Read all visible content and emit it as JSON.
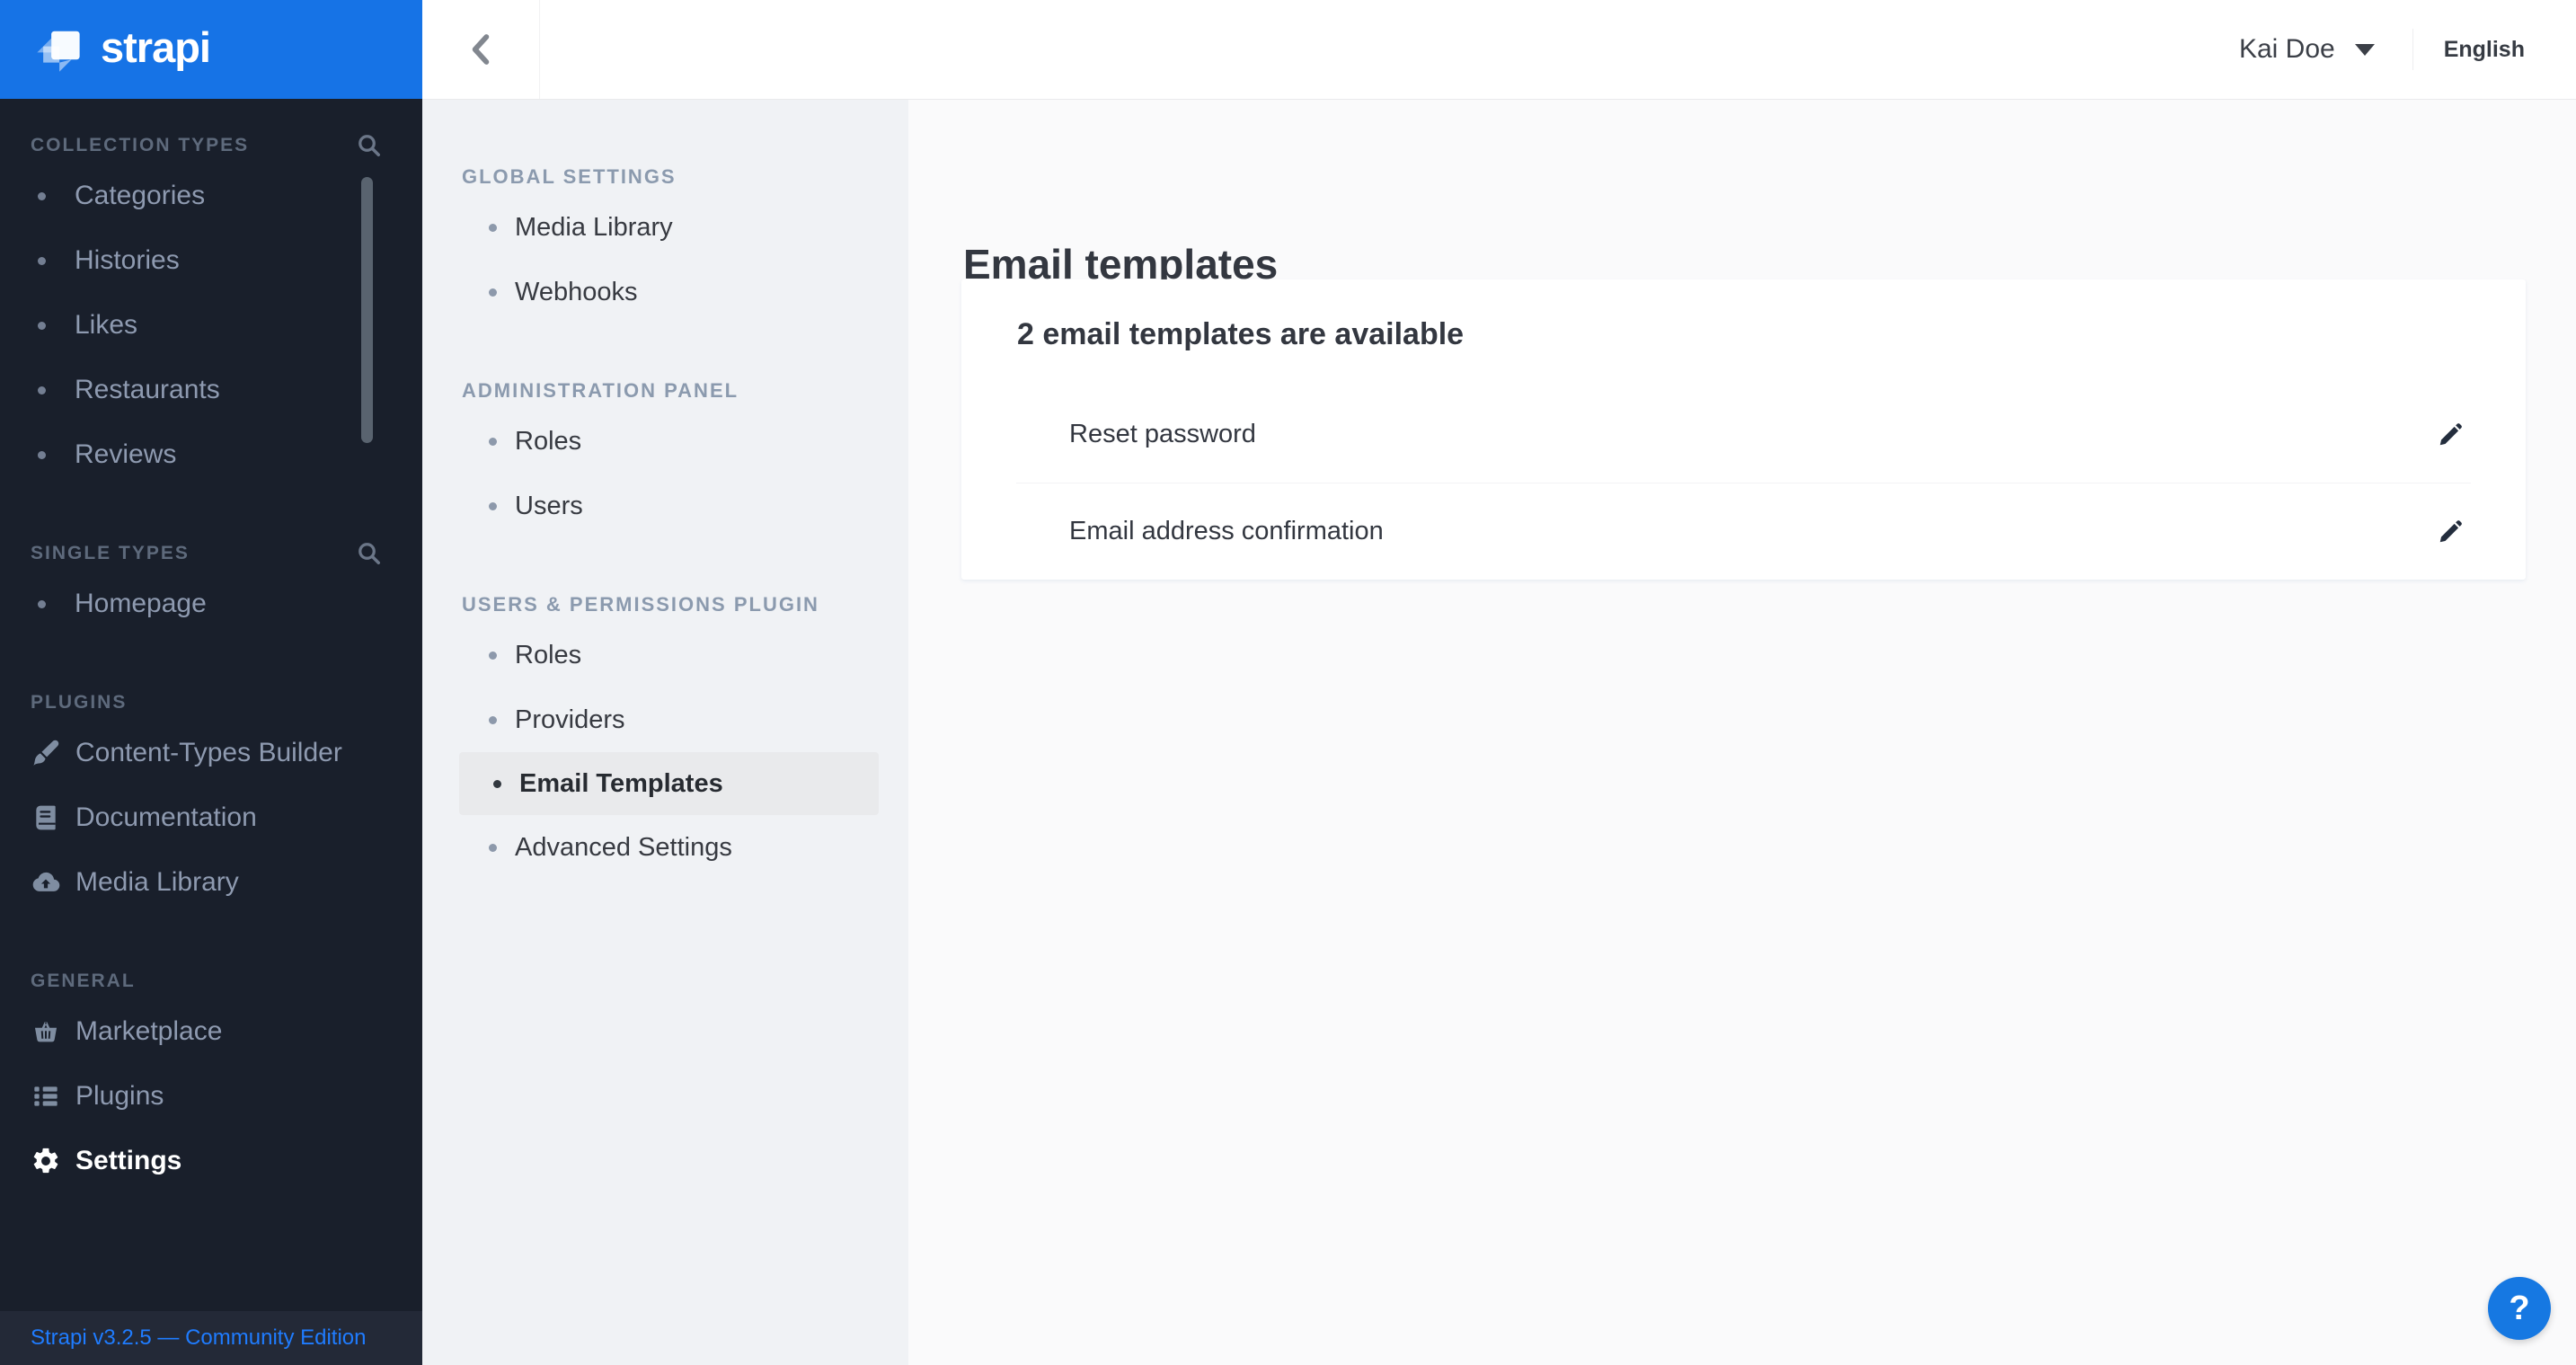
{
  "brand": {
    "name": "strapi"
  },
  "header": {
    "user_name": "Kai Doe",
    "language": "English"
  },
  "main_sidebar": {
    "sections": [
      {
        "label": "COLLECTION TYPES",
        "has_search": true,
        "items": [
          {
            "label": "Categories"
          },
          {
            "label": "Histories"
          },
          {
            "label": "Likes"
          },
          {
            "label": "Restaurants"
          },
          {
            "label": "Reviews"
          }
        ]
      },
      {
        "label": "SINGLE TYPES",
        "has_search": true,
        "items": [
          {
            "label": "Homepage"
          }
        ]
      },
      {
        "label": "PLUGINS",
        "items": [
          {
            "label": "Content-Types Builder",
            "icon": "paintbrush-icon"
          },
          {
            "label": "Documentation",
            "icon": "book-icon"
          },
          {
            "label": "Media Library",
            "icon": "cloud-upload-icon"
          }
        ]
      },
      {
        "label": "GENERAL",
        "items": [
          {
            "label": "Marketplace",
            "icon": "basket-icon"
          },
          {
            "label": "Plugins",
            "icon": "list-icon"
          },
          {
            "label": "Settings",
            "icon": "gear-icon",
            "active": true
          }
        ]
      }
    ],
    "footer": {
      "version_label": "Strapi v3.2.5 — Community Edition"
    }
  },
  "settings_sidebar": {
    "sections": [
      {
        "label": "GLOBAL SETTINGS",
        "items": [
          "Media Library",
          "Webhooks"
        ]
      },
      {
        "label": "ADMINISTRATION PANEL",
        "items": [
          "Roles",
          "Users"
        ]
      },
      {
        "label": "USERS & PERMISSIONS PLUGIN",
        "items": [
          "Roles",
          "Providers",
          "Email Templates",
          "Advanced Settings"
        ],
        "selected_item": "Email Templates"
      }
    ]
  },
  "content": {
    "page_title": "Email templates",
    "card": {
      "title": "2 email templates are available",
      "rows": [
        {
          "label": "Reset password"
        },
        {
          "label": "Email address confirmation"
        }
      ]
    }
  },
  "help": {
    "label": "?"
  },
  "colors": {
    "accent_blue": "#1673e6",
    "help_button_blue": "#1678e2",
    "version_link_blue": "#1f7cff",
    "sidebar_dark": "#191f2b",
    "selected_item_bg": "#e9eaec"
  }
}
